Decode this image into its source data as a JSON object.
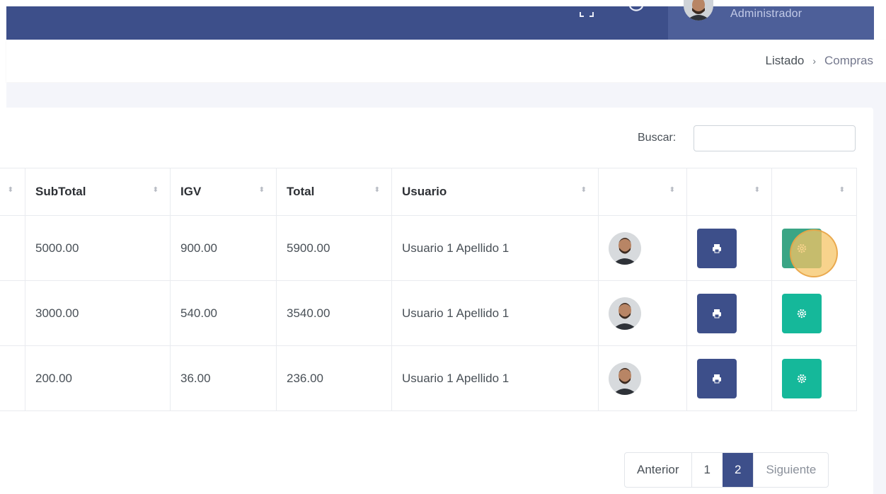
{
  "header": {
    "user_role": "Administrador",
    "icons": [
      "fullscreen-icon",
      "power-icon",
      "user-avatar"
    ]
  },
  "breadcrumb": {
    "items": [
      "Listado",
      "Compras"
    ],
    "separator": "›"
  },
  "search": {
    "label": "Buscar:",
    "value": ""
  },
  "table": {
    "columns": [
      "",
      "SubTotal",
      "IGV",
      "Total",
      "Usuario",
      "",
      "",
      ""
    ],
    "rows": [
      {
        "subtotal": "5000.00",
        "igv": "900.00",
        "total": "5900.00",
        "usuario": "Usuario 1 Apellido 1"
      },
      {
        "subtotal": "3000.00",
        "igv": "540.00",
        "total": "3540.00",
        "usuario": "Usuario 1 Apellido 1"
      },
      {
        "subtotal": "200.00",
        "igv": "36.00",
        "total": "236.00",
        "usuario": "Usuario 1 Apellido 1"
      }
    ]
  },
  "pagination": {
    "prev": "Anterior",
    "pages": [
      "1",
      "2"
    ],
    "active": "2",
    "next": "Siguiente"
  },
  "colors": {
    "primary": "#3d4f8a",
    "success": "#15b89a",
    "background": "#f4f5fa"
  }
}
